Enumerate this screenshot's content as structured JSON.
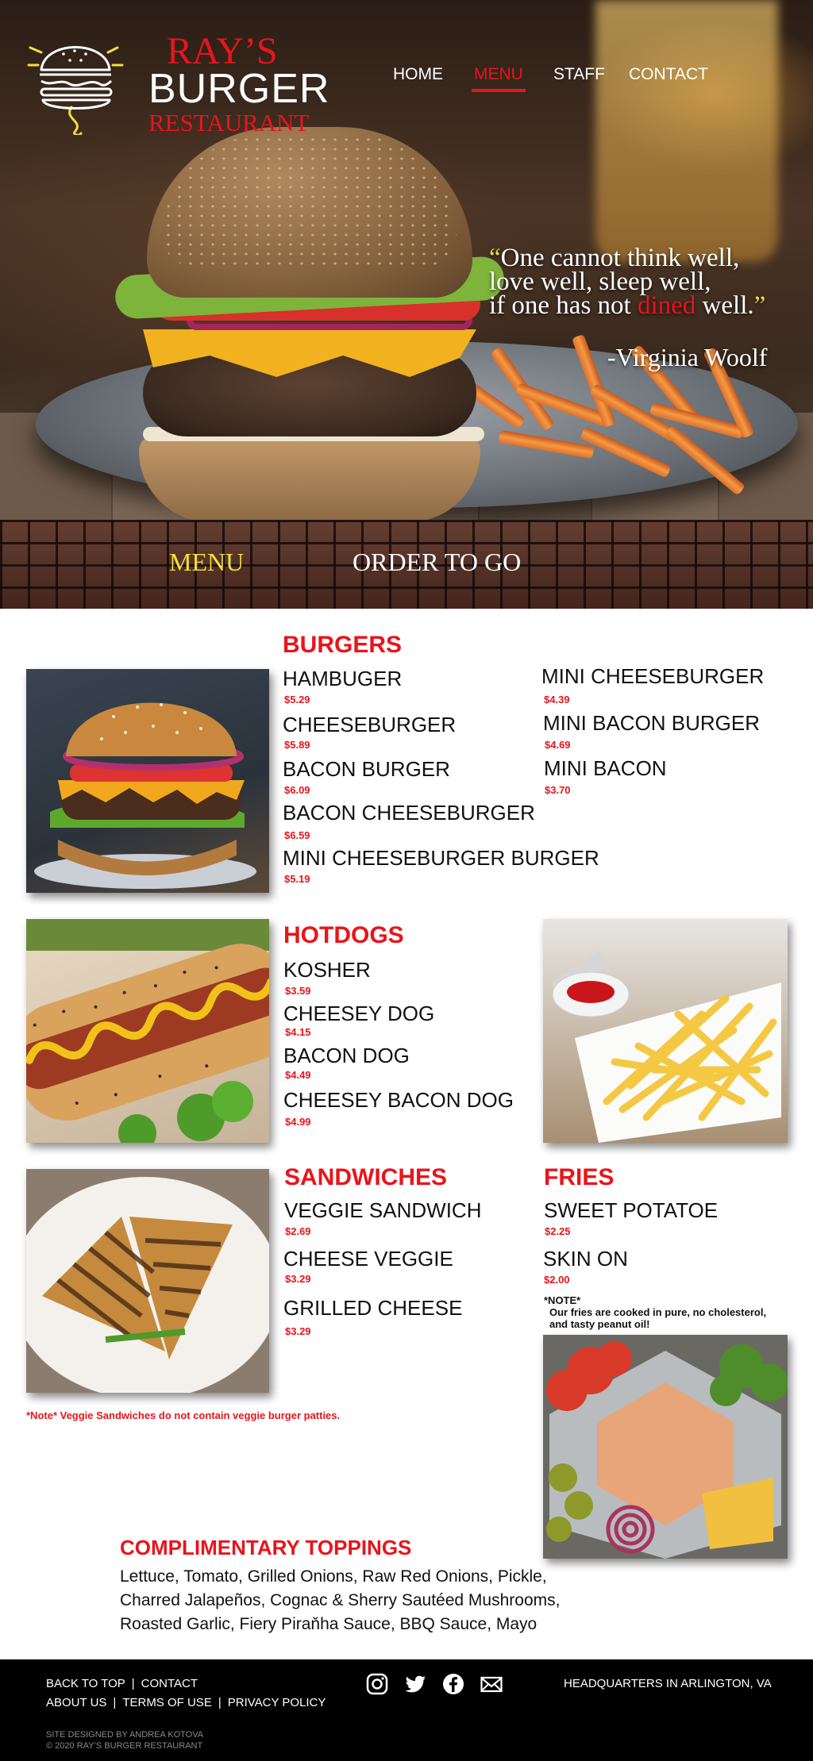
{
  "brand": {
    "line1": "RAY’S",
    "line2": "BURGER",
    "line3": "RESTAURANT",
    "colors": {
      "red": "#e8141b",
      "yellow": "#f2df3a",
      "black": "#000000",
      "white": "#ffffff"
    }
  },
  "nav": {
    "items": [
      {
        "label": "HOME"
      },
      {
        "label": "MENU",
        "active": true
      },
      {
        "label": "STAFF"
      },
      {
        "label": "CONTACT"
      }
    ]
  },
  "hero": {
    "quote_open": "“",
    "quote_part1": "One cannot think well,",
    "quote_part2": "love well, sleep well,",
    "quote_part3_a": "if one has not ",
    "quote_part3_red": "dined",
    "quote_part3_b": " well.",
    "quote_close": "”",
    "author": "-Virginia Woolf"
  },
  "subnav": {
    "menu": "MENU",
    "order": "ORDER TO GO"
  },
  "menu": {
    "burgers": {
      "title": "BURGERS",
      "col1": [
        {
          "name": "HAMBUGER",
          "price": "$5.29"
        },
        {
          "name": "CHEESEBURGER",
          "price": "$5.89"
        },
        {
          "name": "BACON BURGER",
          "price": "$6.09"
        },
        {
          "name": "BACON CHEESEBURGER",
          "price": "$6.59"
        },
        {
          "name": "MINI CHEESEBURGER BURGER",
          "price": "$5.19"
        }
      ],
      "col2": [
        {
          "name": "MINI CHEESEBURGER",
          "price": "$4.39"
        },
        {
          "name": "MINI BACON BURGER",
          "price": "$4.69"
        },
        {
          "name": "MINI BACON",
          "price": "$3.70"
        }
      ]
    },
    "hotdogs": {
      "title": "HOTDOGS",
      "items": [
        {
          "name": "KOSHER",
          "price": "$3.59"
        },
        {
          "name": "CHEESEY DOG",
          "price": "$4.15"
        },
        {
          "name": "BACON DOG",
          "price": "$4.49"
        },
        {
          "name": "CHEESEY BACON DOG",
          "price": "$4.99"
        }
      ]
    },
    "sandwiches": {
      "title": "SANDWICHES",
      "items": [
        {
          "name": "VEGGIE SANDWICH",
          "price": "$2.69"
        },
        {
          "name": "CHEESE VEGGIE",
          "price": "$3.29"
        },
        {
          "name": "GRILLED CHEESE",
          "price": "$3.29"
        }
      ],
      "note": "*Note* Veggie Sandwiches do not contain veggie burger patties."
    },
    "fries": {
      "title": "FRIES",
      "items": [
        {
          "name": "SWEET POTATOE",
          "price": "$2.25"
        },
        {
          "name": "SKIN ON",
          "price": "$2.00"
        }
      ],
      "note_label": "*NOTE*",
      "note_line1": "Our fries are cooked in pure, no cholesterol,",
      "note_line2": "and tasty peanut oil!"
    },
    "toppings": {
      "title": "COMPLIMENTARY TOPPINGS",
      "line1": "Lettuce, Tomato, Grilled Onions, Raw Red Onions, Pickle,",
      "line2": "Charred Jalapeños, Cognac & Sherry Sautéed Mushrooms,",
      "line3": "Roasted Garlic, Fiery Piraňha Sauce, BBQ Sauce, Mayo"
    }
  },
  "footer": {
    "back_to_top": "BACK TO TOP",
    "contact": "CONTACT",
    "about": "ABOUT US",
    "terms": "TERMS OF USE",
    "privacy": "PRIVACY POLICY",
    "sep": "|",
    "credit1": "SITE DESIGNED BY ANDREA KOTOVA",
    "credit2": "© 2020 RAY’S BURGER RESTAURANT",
    "hq": "HEADQUARTERS IN ARLINGTON, VA",
    "social_icons": [
      "instagram-icon",
      "twitter-icon",
      "facebook-icon",
      "mail-icon"
    ]
  }
}
